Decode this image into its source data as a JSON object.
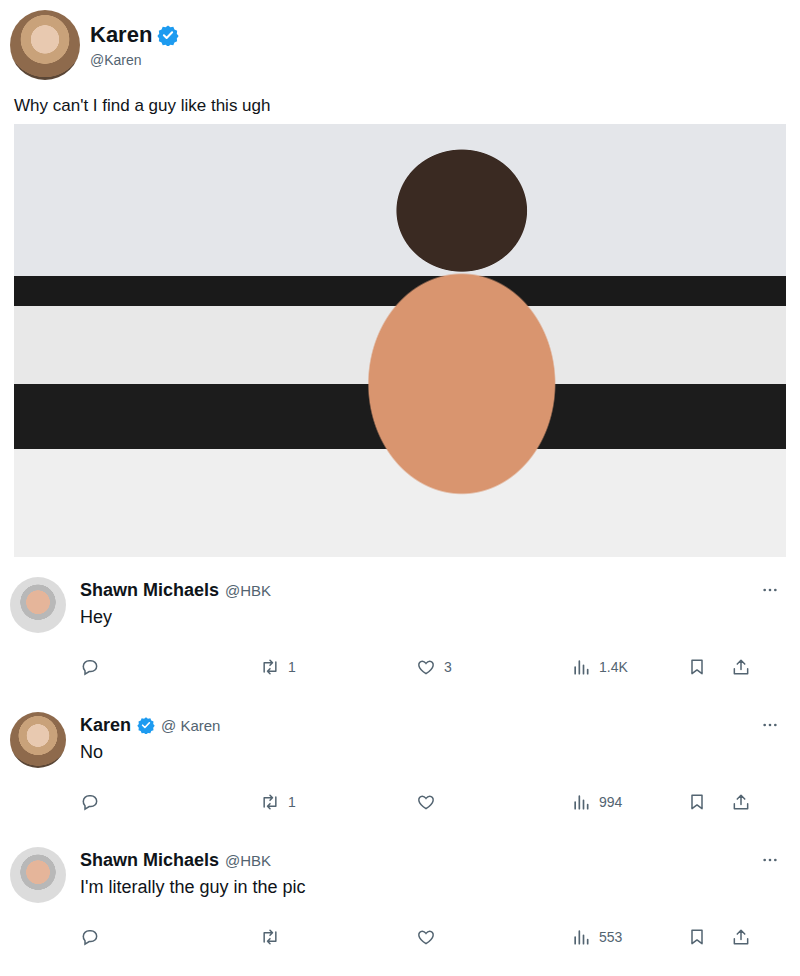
{
  "post": {
    "author": {
      "name": "Karen",
      "handle": "@Karen",
      "verified": true
    },
    "text": "Why can't I find a guy like this ugh"
  },
  "replies": [
    {
      "name": "Shawn Michaels",
      "handle": "@HBK",
      "verified": false,
      "text": "Hey",
      "retweets": "1",
      "likes": "3",
      "views": "1.4K",
      "avatar": "shawn"
    },
    {
      "name": "Karen",
      "handle": "@ Karen",
      "verified": true,
      "text": "No",
      "retweets": "1",
      "likes": "",
      "views": "994",
      "avatar": "karen"
    },
    {
      "name": "Shawn Michaels",
      "handle": "@HBK",
      "verified": false,
      "text": "I'm literally the guy in the pic",
      "retweets": "",
      "likes": "",
      "views": "553",
      "avatar": "shawn"
    }
  ]
}
